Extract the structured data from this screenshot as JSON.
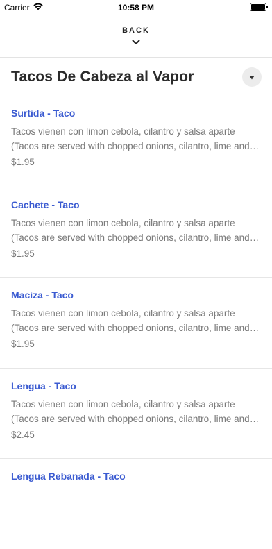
{
  "status_bar": {
    "carrier": "Carrier",
    "time": "10:58 PM",
    "battery_level": 1.0
  },
  "nav": {
    "back_label": "BACK",
    "back_icon": "chevron-down-icon"
  },
  "category": {
    "title": "Tacos De Cabeza al Vapor",
    "dropdown_icon": "caret-down-icon"
  },
  "items": [
    {
      "name": "Surtida - Taco",
      "description": "Tacos vienen con limon cebola, cilantro y salsa aparte (Tacos are served with chopped onions, cilantro, lime and salsa on the side)",
      "price": "$1.95"
    },
    {
      "name": "Cachete - Taco",
      "description": "Tacos vienen con limon cebola, cilantro y salsa aparte (Tacos are served with chopped onions, cilantro, lime and salsa on the side)",
      "price": "$1.95"
    },
    {
      "name": "Maciza - Taco",
      "description": "Tacos vienen con limon cebola, cilantro y salsa aparte (Tacos are served with chopped onions, cilantro, lime and salsa on the side)",
      "price": "$1.95"
    },
    {
      "name": "Lengua - Taco",
      "description": "Tacos vienen con limon cebola, cilantro y salsa aparte (Tacos are served with chopped onions, cilantro, lime and salsa on the side)",
      "price": "$2.45"
    },
    {
      "name": "Lengua Rebanada - Taco",
      "description": "",
      "price": ""
    }
  ],
  "colors": {
    "item_name": "#3b5bd1",
    "secondary_text": "#7a7a7a",
    "divider": "#e6e6e6"
  }
}
